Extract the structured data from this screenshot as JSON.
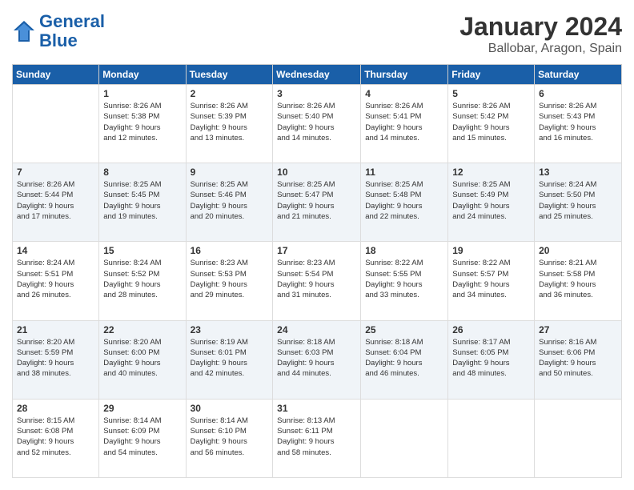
{
  "header": {
    "logo_line1": "General",
    "logo_line2": "Blue",
    "month_title": "January 2024",
    "location": "Ballobar, Aragon, Spain"
  },
  "weekdays": [
    "Sunday",
    "Monday",
    "Tuesday",
    "Wednesday",
    "Thursday",
    "Friday",
    "Saturday"
  ],
  "weeks": [
    [
      {
        "day": "",
        "info": ""
      },
      {
        "day": "1",
        "info": "Sunrise: 8:26 AM\nSunset: 5:38 PM\nDaylight: 9 hours\nand 12 minutes."
      },
      {
        "day": "2",
        "info": "Sunrise: 8:26 AM\nSunset: 5:39 PM\nDaylight: 9 hours\nand 13 minutes."
      },
      {
        "day": "3",
        "info": "Sunrise: 8:26 AM\nSunset: 5:40 PM\nDaylight: 9 hours\nand 14 minutes."
      },
      {
        "day": "4",
        "info": "Sunrise: 8:26 AM\nSunset: 5:41 PM\nDaylight: 9 hours\nand 14 minutes."
      },
      {
        "day": "5",
        "info": "Sunrise: 8:26 AM\nSunset: 5:42 PM\nDaylight: 9 hours\nand 15 minutes."
      },
      {
        "day": "6",
        "info": "Sunrise: 8:26 AM\nSunset: 5:43 PM\nDaylight: 9 hours\nand 16 minutes."
      }
    ],
    [
      {
        "day": "7",
        "info": "Sunrise: 8:26 AM\nSunset: 5:44 PM\nDaylight: 9 hours\nand 17 minutes."
      },
      {
        "day": "8",
        "info": "Sunrise: 8:25 AM\nSunset: 5:45 PM\nDaylight: 9 hours\nand 19 minutes."
      },
      {
        "day": "9",
        "info": "Sunrise: 8:25 AM\nSunset: 5:46 PM\nDaylight: 9 hours\nand 20 minutes."
      },
      {
        "day": "10",
        "info": "Sunrise: 8:25 AM\nSunset: 5:47 PM\nDaylight: 9 hours\nand 21 minutes."
      },
      {
        "day": "11",
        "info": "Sunrise: 8:25 AM\nSunset: 5:48 PM\nDaylight: 9 hours\nand 22 minutes."
      },
      {
        "day": "12",
        "info": "Sunrise: 8:25 AM\nSunset: 5:49 PM\nDaylight: 9 hours\nand 24 minutes."
      },
      {
        "day": "13",
        "info": "Sunrise: 8:24 AM\nSunset: 5:50 PM\nDaylight: 9 hours\nand 25 minutes."
      }
    ],
    [
      {
        "day": "14",
        "info": "Sunrise: 8:24 AM\nSunset: 5:51 PM\nDaylight: 9 hours\nand 26 minutes."
      },
      {
        "day": "15",
        "info": "Sunrise: 8:24 AM\nSunset: 5:52 PM\nDaylight: 9 hours\nand 28 minutes."
      },
      {
        "day": "16",
        "info": "Sunrise: 8:23 AM\nSunset: 5:53 PM\nDaylight: 9 hours\nand 29 minutes."
      },
      {
        "day": "17",
        "info": "Sunrise: 8:23 AM\nSunset: 5:54 PM\nDaylight: 9 hours\nand 31 minutes."
      },
      {
        "day": "18",
        "info": "Sunrise: 8:22 AM\nSunset: 5:55 PM\nDaylight: 9 hours\nand 33 minutes."
      },
      {
        "day": "19",
        "info": "Sunrise: 8:22 AM\nSunset: 5:57 PM\nDaylight: 9 hours\nand 34 minutes."
      },
      {
        "day": "20",
        "info": "Sunrise: 8:21 AM\nSunset: 5:58 PM\nDaylight: 9 hours\nand 36 minutes."
      }
    ],
    [
      {
        "day": "21",
        "info": "Sunrise: 8:20 AM\nSunset: 5:59 PM\nDaylight: 9 hours\nand 38 minutes."
      },
      {
        "day": "22",
        "info": "Sunrise: 8:20 AM\nSunset: 6:00 PM\nDaylight: 9 hours\nand 40 minutes."
      },
      {
        "day": "23",
        "info": "Sunrise: 8:19 AM\nSunset: 6:01 PM\nDaylight: 9 hours\nand 42 minutes."
      },
      {
        "day": "24",
        "info": "Sunrise: 8:18 AM\nSunset: 6:03 PM\nDaylight: 9 hours\nand 44 minutes."
      },
      {
        "day": "25",
        "info": "Sunrise: 8:18 AM\nSunset: 6:04 PM\nDaylight: 9 hours\nand 46 minutes."
      },
      {
        "day": "26",
        "info": "Sunrise: 8:17 AM\nSunset: 6:05 PM\nDaylight: 9 hours\nand 48 minutes."
      },
      {
        "day": "27",
        "info": "Sunrise: 8:16 AM\nSunset: 6:06 PM\nDaylight: 9 hours\nand 50 minutes."
      }
    ],
    [
      {
        "day": "28",
        "info": "Sunrise: 8:15 AM\nSunset: 6:08 PM\nDaylight: 9 hours\nand 52 minutes."
      },
      {
        "day": "29",
        "info": "Sunrise: 8:14 AM\nSunset: 6:09 PM\nDaylight: 9 hours\nand 54 minutes."
      },
      {
        "day": "30",
        "info": "Sunrise: 8:14 AM\nSunset: 6:10 PM\nDaylight: 9 hours\nand 56 minutes."
      },
      {
        "day": "31",
        "info": "Sunrise: 8:13 AM\nSunset: 6:11 PM\nDaylight: 9 hours\nand 58 minutes."
      },
      {
        "day": "",
        "info": ""
      },
      {
        "day": "",
        "info": ""
      },
      {
        "day": "",
        "info": ""
      }
    ]
  ]
}
